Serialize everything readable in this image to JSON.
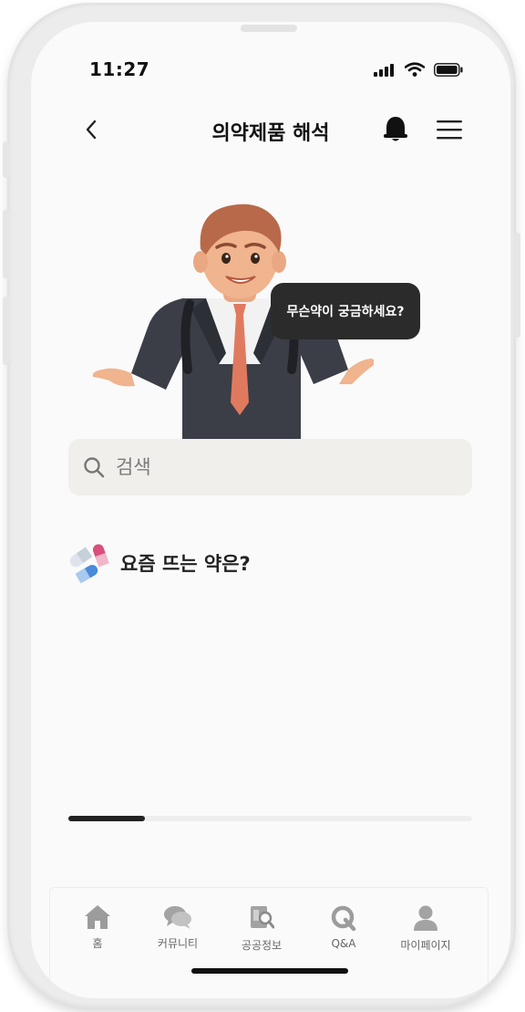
{
  "status_bar": {
    "time": "11:27"
  },
  "header": {
    "title": "의약제품 해석"
  },
  "hero": {
    "speech_bubble": "무슨약이 궁금하세요?"
  },
  "search": {
    "placeholder": "검색"
  },
  "section": {
    "title": "요즘 뜨는 약은?"
  },
  "carousel": {
    "progress": 0.19
  },
  "tabbar": {
    "items": [
      {
        "label": "홈",
        "icon": "home-icon"
      },
      {
        "label": "커뮤니티",
        "icon": "chat-bubbles-icon"
      },
      {
        "label": "공공정보",
        "icon": "document-search-icon"
      },
      {
        "label": "Q&A",
        "icon": "q-icon"
      },
      {
        "label": "마이페이지",
        "icon": "person-icon"
      }
    ]
  },
  "colors": {
    "accent": "#2b2b2b",
    "search_bg": "#f1efeb",
    "background": "#fafafa"
  }
}
